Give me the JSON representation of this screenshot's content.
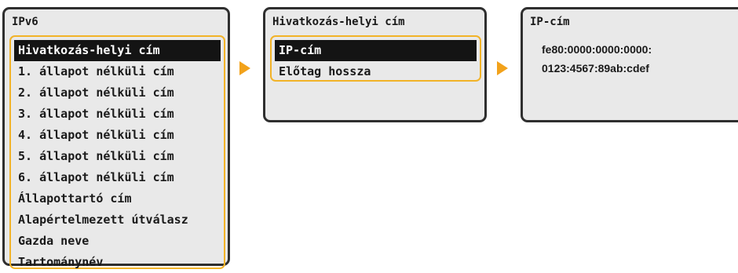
{
  "screens": [
    {
      "title": "IPv6",
      "items": [
        "Hivatkozás-helyi cím",
        "1. állapot nélküli cím",
        "2. állapot nélküli cím",
        "3. állapot nélküli cím",
        "4. állapot nélküli cím",
        "5. állapot nélküli cím",
        "6. állapot nélküli cím",
        "Állapottartó cím",
        "Alapértelmezett útválasz",
        "Gazda neve",
        "Tartománynév"
      ],
      "selected_index": 0
    },
    {
      "title": "Hivatkozás-helyi cím",
      "items": [
        "IP-cím",
        "Előtag hossza"
      ],
      "selected_index": 0
    },
    {
      "title": "IP-cím",
      "value_lines": [
        "fe80:0000:0000:0000:",
        "0123:4567:89ab:cdef"
      ]
    }
  ],
  "colors": {
    "highlight_frame": "#f2b328",
    "arrow": "#f2a21b",
    "selected_bg": "#141414",
    "screen_bg": "#e9e9e9"
  },
  "icons": [
    "right-arrow-icon",
    "right-arrow-icon"
  ]
}
